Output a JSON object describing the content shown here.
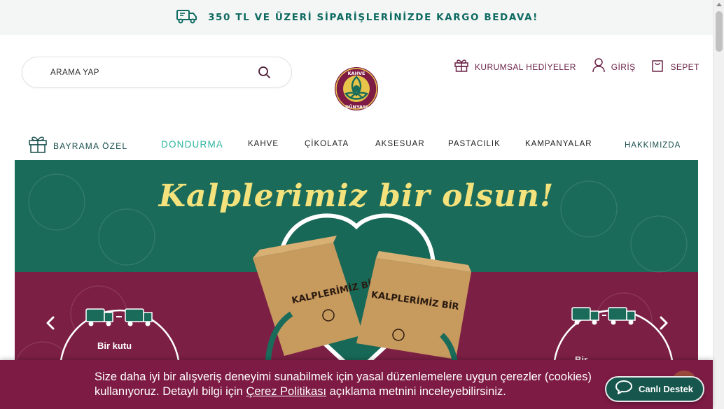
{
  "promo": {
    "text": "350 TL VE ÜZERİ SİPARİŞLERİNİZDE KARGO BEDAVA!",
    "icon": "delivery-truck-icon"
  },
  "search": {
    "placeholder": "ARAMA YAP"
  },
  "logo": {
    "top_text": "KAHVE",
    "bottom_text": "DÜNYASI"
  },
  "header": {
    "corporate_gifts": "KURUMSAL HEDİYELER",
    "login": "GİRİŞ",
    "cart": "SEPET"
  },
  "nav": {
    "bayram": "BAYRAMA ÖZEL",
    "items": [
      "DONDURMA",
      "KAHVE",
      "ÇİKOLATA",
      "AKSESUAR",
      "PASTACILIK",
      "KAMPANYALAR"
    ],
    "about": "HAKKIMIZDA"
  },
  "hero": {
    "title": "Kalplerimiz bir olsun!",
    "box_text_1": "KALPLERİMİZ BİR",
    "box_text_2": "KALPLERİMİZ BİR",
    "left_card_label": "Bir kutu",
    "right_card_label": "Bir ...",
    "colors": {
      "green": "#1a6b5a",
      "maroon": "#7c1f45",
      "title": "#f4e27c"
    }
  },
  "cookie": {
    "text_before": "Size daha iyi bir alışveriş deneyimi sunabilmek için yasal düzenlemelere uygun çerezler (cookies) kullanıyoruz. Detaylı bilgi için ",
    "link": "Çerez Politikası",
    "text_after": " açıklama metnini inceleyebilirsiniz."
  },
  "live_support": {
    "label": "Canlı Destek"
  }
}
